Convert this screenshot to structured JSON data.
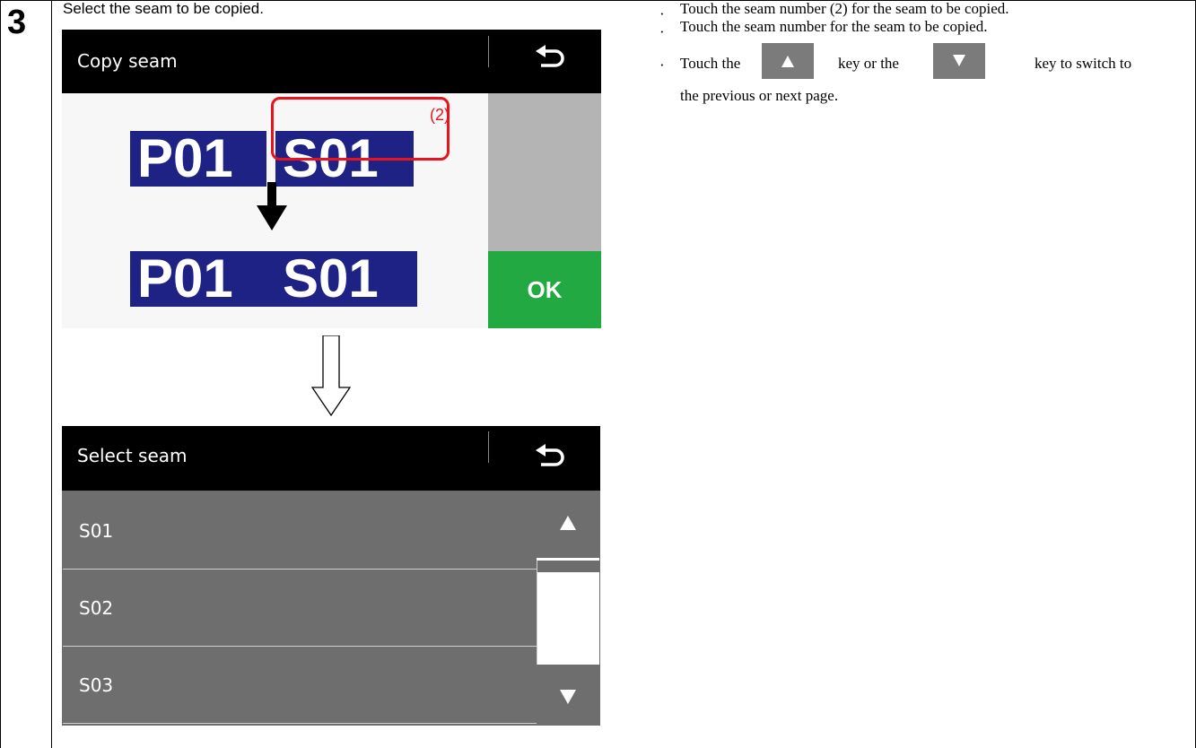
{
  "step": {
    "number": "3",
    "instruction": "Select the seam to be copied."
  },
  "screen_copy": {
    "title": "Copy seam",
    "back_icon": "return-arrow-icon",
    "source": {
      "pattern": "P01",
      "seam": "S01"
    },
    "dest": {
      "pattern": "P01",
      "seam": "S01"
    },
    "callout": "(2)",
    "ok_label": "OK"
  },
  "screen_select": {
    "title": "Select seam",
    "back_icon": "return-arrow-icon",
    "items": [
      {
        "label": "S01"
      },
      {
        "label": "S02"
      },
      {
        "label": "S03"
      }
    ],
    "scroll_up_icon": "triangle-up-icon",
    "scroll_down_icon": "triangle-down-icon"
  },
  "notes": {
    "line1": "Touch the seam number (2) for the seam to be copied.",
    "line2": "Touch the seam number for the seam to be copied.",
    "line3_a": "Touch the",
    "line3_b": "key or the",
    "line3_c": "key to switch to",
    "line3_d": "the previous or next page."
  },
  "colors": {
    "code_bg": "#1d2284",
    "highlight": "#e8131d",
    "ok_green": "#22a942",
    "list_gray": "#6e6e6e"
  }
}
